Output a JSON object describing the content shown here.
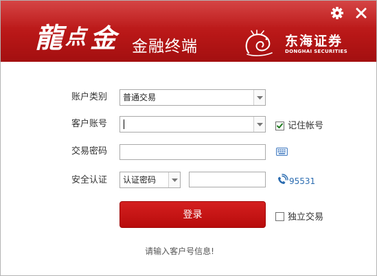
{
  "header": {
    "logo_chars": [
      "龍",
      "点",
      "金"
    ],
    "app_title": "金融终端",
    "broker_name_cn": "东海证券",
    "broker_name_en": "DONGHAI SECURITIES"
  },
  "form": {
    "account_type": {
      "label": "账户类别",
      "value": "普通交易"
    },
    "account": {
      "label": "客户账号",
      "value": ""
    },
    "remember": {
      "label": "记住帐号",
      "checked": true
    },
    "password": {
      "label": "交易密码",
      "value": ""
    },
    "security": {
      "label": "安全认证",
      "method": "认证密码",
      "value": ""
    },
    "hotline": "95531",
    "login_label": "登录",
    "independent": {
      "label": "独立交易",
      "checked": false
    }
  },
  "status_hint": "请输入客户号信息!",
  "colors": {
    "brand_red": "#b81717",
    "link_blue": "#2b6cb0"
  },
  "icons": [
    "gear-icon",
    "close-icon",
    "keyboard-icon",
    "phone-icon",
    "chevron-down-icon",
    "checkmark-icon"
  ]
}
